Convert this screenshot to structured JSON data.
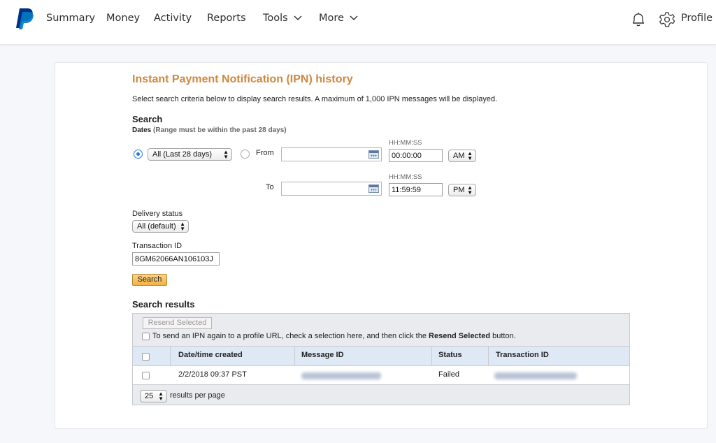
{
  "nav": {
    "items": [
      {
        "label": "Summary"
      },
      {
        "label": "Money"
      },
      {
        "label": "Activity"
      },
      {
        "label": "Reports"
      },
      {
        "label": "Tools"
      },
      {
        "label": "More"
      }
    ],
    "profile_label": "Profile",
    "icons": [
      "paypal-logo",
      "chevron-down-icon",
      "bell-icon",
      "gear-icon"
    ]
  },
  "page": {
    "title": "Instant Payment Notification (IPN) history",
    "intro": "Select search criteria below to display search results. A maximum of 1,000 IPN messages will be displayed."
  },
  "search": {
    "heading": "Search",
    "dates_label": "Dates",
    "dates_note": "(Range must be within the past 28 days)",
    "range_select": "All (Last 28 days)",
    "from_label": "From",
    "to_label": "To",
    "time_format_label": "HH:MM:SS",
    "from_time": "00:00:00",
    "from_ampm": "AM",
    "to_time": "11:59:59",
    "to_ampm": "PM",
    "from_date": "",
    "to_date": "",
    "delivery_status_label": "Delivery status",
    "delivery_status_value": "All (default)",
    "transaction_id_label": "Transaction ID",
    "transaction_id_value": "8GM62066AN106103J",
    "search_button": "Search"
  },
  "results": {
    "heading": "Search results",
    "resend_button": "Resend Selected",
    "hint_prefix": "To send an IPN again to a profile URL, check a selection here, and then click the ",
    "hint_bold": "Resend Selected",
    "hint_suffix": " button.",
    "columns": [
      "Date/time created",
      "Message ID",
      "Status",
      "Transaction ID"
    ],
    "rows": [
      {
        "date": "2/2/2018 09:37 PST",
        "message_id": "",
        "status": "Failed",
        "transaction_id": ""
      }
    ],
    "per_page_value": "25",
    "per_page_label": "results per page"
  },
  "colors": {
    "title": "#d0883f",
    "accent_blue": "#2a7ae2",
    "search_button": "#f5b042",
    "table_header": "#dfe9f5"
  }
}
